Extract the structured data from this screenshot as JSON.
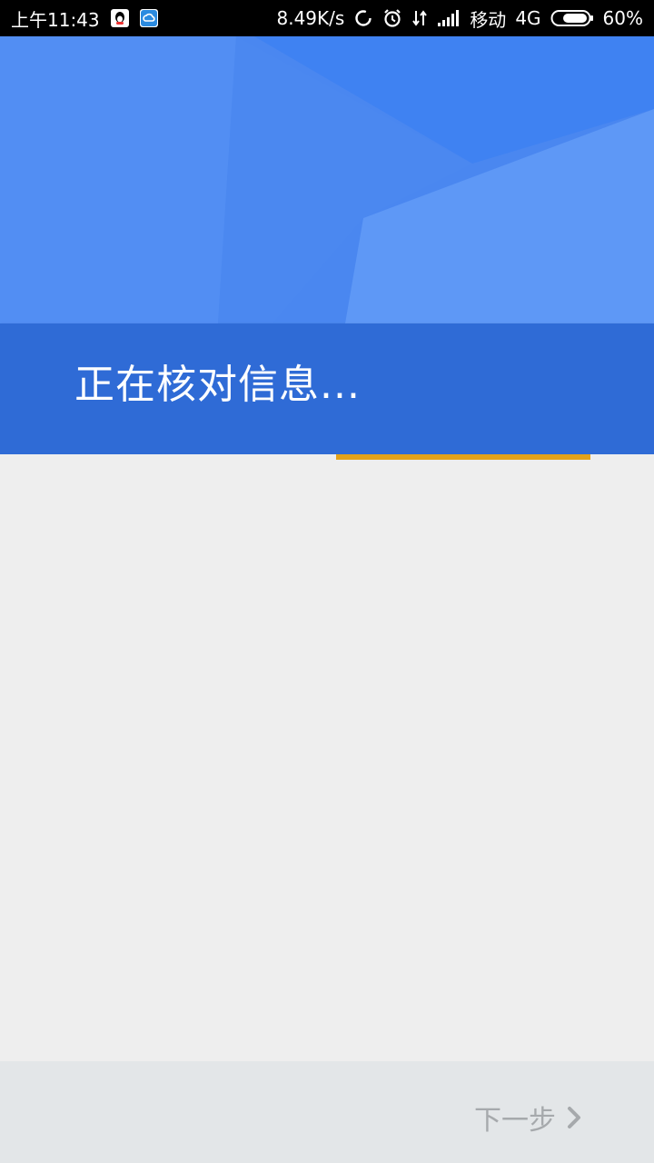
{
  "status_bar": {
    "time": "上午11:43",
    "net_speed": "8.49K/s",
    "carrier": "移动",
    "network": "4G",
    "battery": "60%"
  },
  "header": {
    "title": "正在核对信息..."
  },
  "progress": {
    "fraction": 0.39
  },
  "footer": {
    "next_label": "下一步"
  },
  "icons": {
    "qq": "qq-icon",
    "cloud": "cloud-icon",
    "sync": "sync-icon",
    "alarm": "alarm-icon",
    "data_arrows": "data-arrows-icon",
    "signal": "signal-icon",
    "battery": "battery-icon",
    "next": "chevron-right-icon"
  },
  "colors": {
    "header_blue": "#4a87f0",
    "band_blue": "#2f6bd6",
    "progress_yellow": "#e3a21a",
    "footer_bg": "#e3e6e8"
  }
}
